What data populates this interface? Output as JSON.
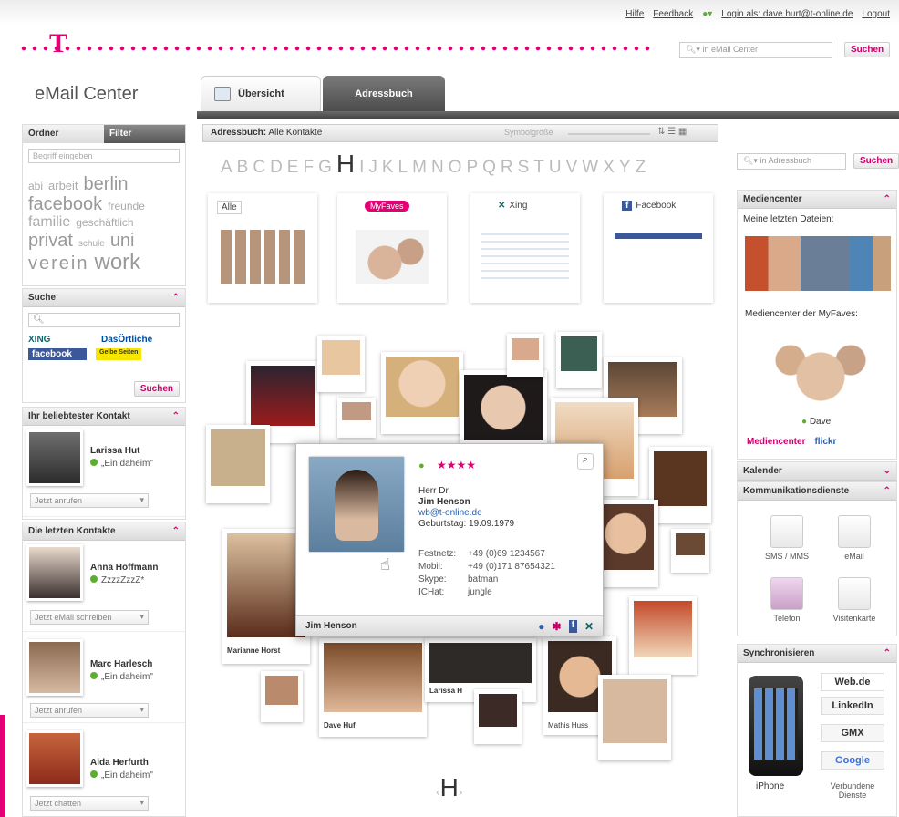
{
  "header": {
    "links": {
      "help": "Hilfe",
      "feedback": "Feedback",
      "login": "Login als: dave.hurt@t-online.de",
      "logout": "Logout"
    },
    "search": {
      "placeholder": "in eMail Center",
      "button": "Suchen"
    },
    "brand_color": "#e20074"
  },
  "app": {
    "title": "eMail Center"
  },
  "tabs": [
    {
      "label": "Übersicht"
    },
    {
      "label": "Adressbuch"
    }
  ],
  "left": {
    "folder_tabs": {
      "folders": "Ordner",
      "filter": "Filter"
    },
    "tag_input_placeholder": "Begriff eingeben",
    "tags": [
      "abi",
      "arbeit",
      "berlin",
      "facebook",
      "freunde",
      "familie",
      "geschäftlich",
      "privat",
      "schule",
      "uni",
      "verein",
      "work"
    ],
    "search": {
      "title": "Suche",
      "sources": [
        "XING",
        "DasÖrtliche",
        "facebook",
        "Gelbe Seiten"
      ],
      "button": "Suchen"
    },
    "favorite": {
      "title": "Ihr beliebtester Kontakt",
      "name": "Larissa Hut",
      "status": "„Ein daheim\"",
      "action": "Jetzt anrufen"
    },
    "recent": {
      "title": "Die letzten Kontakte",
      "items": [
        {
          "name": "Anna Hoffmann",
          "status": "ZzzzZzzZ*",
          "action": "Jetzt eMail schreiben"
        },
        {
          "name": "Marc Harlesch",
          "status": "„Ein daheim\"",
          "action": "Jetzt anrufen"
        },
        {
          "name": "Aida Herfurth",
          "status": "„Ein daheim\"",
          "action": "Jetzt chatten"
        }
      ]
    }
  },
  "main": {
    "breadcrumb_label": "Adressbuch:",
    "breadcrumb_value": "Alle Kontakte",
    "sort_label": "Symbolgröße",
    "alphabet": "ABCDEFG",
    "alphabet_active": "H",
    "alphabet_rest": "IJKLMNOPQRSTUVWXYZ",
    "search": {
      "placeholder": "in Adressbuch",
      "button": "Suchen"
    },
    "categories": [
      "Alle",
      "MyFaves",
      "Xing",
      "Facebook"
    ],
    "cards": [
      "Marianne Horst",
      "Dave Huf",
      "Larissa H",
      "Mathis Huss",
      "Jim Henson"
    ],
    "current_letter": "H"
  },
  "popup": {
    "rating": "★★★★",
    "salutation": "Herr Dr.",
    "name": "Jim Henson",
    "email": "wb@t-online.de",
    "birthday": "Geburtstag: 19.09.1979",
    "phones": [
      {
        "label": "Festnetz:",
        "value": "+49 (0)69 1234567"
      },
      {
        "label": "Mobil:",
        "value": "+49 (0)171 87654321"
      },
      {
        "label": "Skype:",
        "value": "batman"
      },
      {
        "label": "ICHat:",
        "value": "jungle"
      }
    ],
    "footer_name": "Jim Henson"
  },
  "right": {
    "media": {
      "title": "Mediencenter",
      "recent": "Meine letzten Dateien:",
      "myfaves": "Mediencenter der MyFaves:",
      "person": "Dave",
      "links": [
        "Mediencenter",
        "flickr"
      ]
    },
    "calendar": "Kalender",
    "comms": {
      "title": "Kommunikationsdienste",
      "items": [
        "SMS / MMS",
        "eMail",
        "Telefon",
        "Visitenkarte"
      ]
    },
    "sync": {
      "title": "Synchronisieren",
      "brands": [
        "Web.de",
        "LinkedIn",
        "GMX",
        "Google"
      ],
      "iphone": "iPhone",
      "connected": "Verbundene Dienste"
    }
  }
}
